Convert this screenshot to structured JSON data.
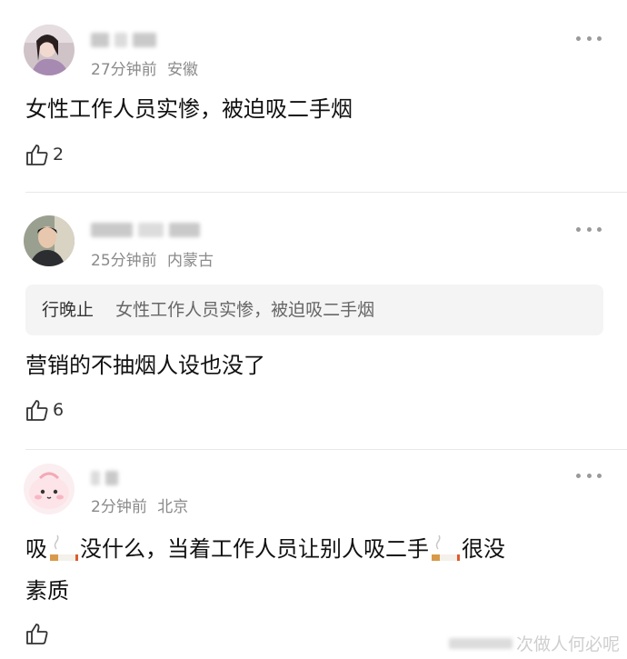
{
  "comments": [
    {
      "time": "27分钟前",
      "location": "安徽",
      "text": "女性工作人员实惨，被迫吸二手烟",
      "likes": "2"
    },
    {
      "time": "25分钟前",
      "location": "内蒙古",
      "quote_author": "行晚止",
      "quote_text": "女性工作人员实惨，被迫吸二手烟",
      "text": "营销的不抽烟人设也没了",
      "likes": "6"
    },
    {
      "time": "2分钟前",
      "location": "北京",
      "text_parts": [
        "吸",
        "没什么，当着工作人员让别人吸二手",
        "很没",
        "素质"
      ],
      "likes": ""
    }
  ],
  "watermark": "次做人何必呢",
  "icons": {
    "more": "more-dots-icon",
    "like": "thumbs-up-icon",
    "cigarette": "cigarette-emoji-icon"
  }
}
